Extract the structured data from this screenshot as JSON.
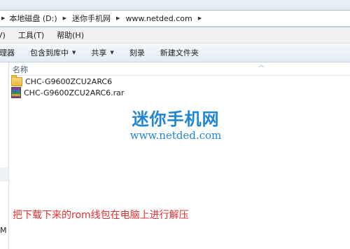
{
  "address": {
    "crumbs": [
      {
        "label": "本地磁盘 (D:)"
      },
      {
        "label": "迷你手机网"
      },
      {
        "label": "www.netded.com"
      }
    ]
  },
  "menubar": {
    "items": [
      {
        "label": "V)"
      },
      {
        "label": "工具(T)"
      },
      {
        "label": "帮助(H)"
      }
    ]
  },
  "toolbar": {
    "organize_label": "理器",
    "include_label": "包含到库中",
    "share_label": "共享",
    "burn_label": "刻录",
    "new_folder_label": "新建文件夹"
  },
  "filelist": {
    "column_name": "名称",
    "items": [
      {
        "name": "CHC-G9600ZCU2ARC6",
        "icon": "folder-icon"
      },
      {
        "name": "CHC-G9600ZCU2ARC6.rar",
        "icon": "rar-archive-icon"
      }
    ]
  },
  "watermark": {
    "title": "迷你手机网",
    "url": "www.netded.com"
  },
  "caption": "把下载下来的rom线包在电脑上进行解压",
  "left_pane": {
    "letter": "M"
  },
  "colors": {
    "accent": "#1f86d8",
    "caption": "#e23030"
  }
}
